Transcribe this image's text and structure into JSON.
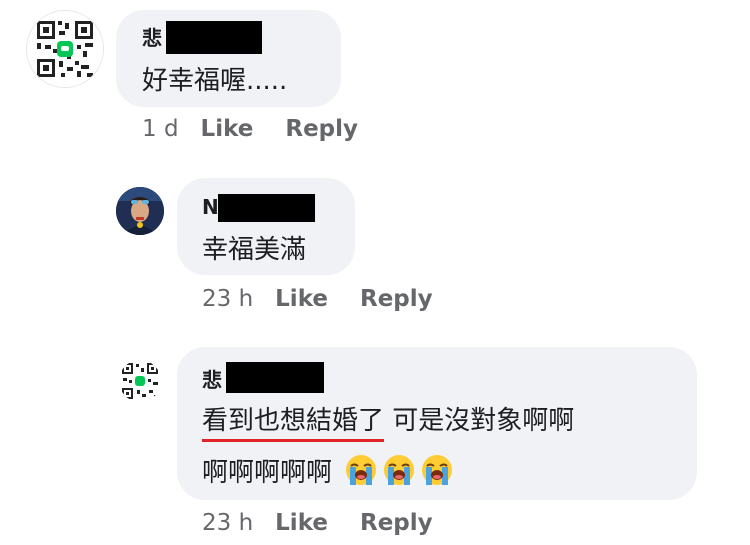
{
  "comments": [
    {
      "name_initial": "悲",
      "text": "好幸福喔.....",
      "time": "1 d",
      "like_label": "Like",
      "reply_label": "Reply",
      "avatar_icon": "qr-code-icon"
    },
    {
      "name_initial": "N",
      "text": "幸福美滿",
      "time": "23 h",
      "like_label": "Like",
      "reply_label": "Reply",
      "avatar_icon": "profile-photo"
    },
    {
      "name_initial": "悲",
      "text_underlined": "看到也想結婚了",
      "text_rest": " 可是沒對象啊啊",
      "text_line2": "啊啊啊啊啊",
      "emoji": [
        "loudly-crying-face-icon",
        "loudly-crying-face-icon",
        "loudly-crying-face-icon"
      ],
      "time": "23 h",
      "like_label": "Like",
      "reply_label": "Reply",
      "avatar_icon": "qr-code-icon"
    }
  ],
  "colors": {
    "bubble": "#f0f2f5",
    "meta_text": "#65676b",
    "underline": "#e0242a",
    "qr_center": "#06c755"
  }
}
